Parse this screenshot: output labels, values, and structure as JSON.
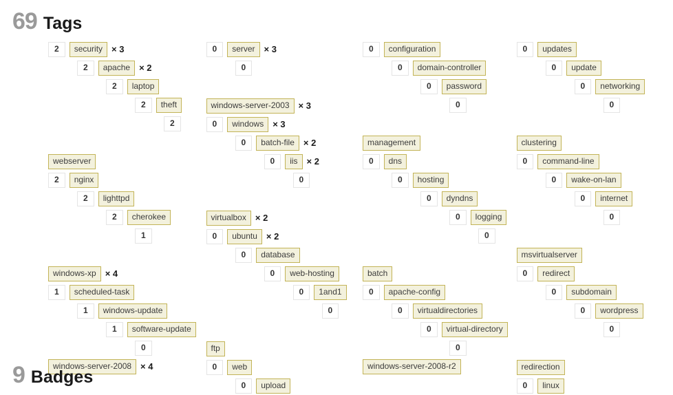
{
  "sections": {
    "tags": {
      "count": "69",
      "title": "Tags"
    },
    "badges": {
      "count": "9",
      "title": "Badges"
    }
  },
  "columns": [
    {
      "groups": [
        {
          "rows": [
            {
              "count": "2",
              "tag": "security",
              "mult": "× 3"
            },
            {
              "indent": 1,
              "count": "2",
              "tag": "apache",
              "mult": "× 2"
            },
            {
              "indent": 2,
              "count": "2",
              "tag": "laptop"
            },
            {
              "indent": 3,
              "count": "2",
              "tag": "theft"
            },
            {
              "indent": 4,
              "count": "2"
            }
          ]
        },
        {
          "rows": [
            {
              "tag": "webserver"
            },
            {
              "count": "2",
              "tag": "nginx"
            },
            {
              "indent": 1,
              "count": "2",
              "tag": "lighttpd"
            },
            {
              "indent": 2,
              "count": "2",
              "tag": "cherokee"
            },
            {
              "indent": 3,
              "count": "1"
            }
          ]
        },
        {
          "rows": [
            {
              "tag": "windows-xp",
              "mult": "× 4"
            },
            {
              "count": "1",
              "tag": "scheduled-task"
            },
            {
              "indent": 1,
              "count": "1",
              "tag": "windows-update"
            },
            {
              "indent": 2,
              "count": "1",
              "tag": "software-update"
            },
            {
              "indent": 3,
              "count": "0"
            },
            {
              "tag": "windows-server-2008",
              "mult": "× 4"
            }
          ]
        }
      ]
    },
    {
      "groups": [
        {
          "rows": [
            {
              "count": "0",
              "tag": "server",
              "mult": "× 3"
            },
            {
              "indent": 1,
              "count": "0"
            }
          ]
        },
        {
          "rows": [
            {
              "tag": "windows-server-2003",
              "mult": "× 3"
            },
            {
              "count": "0",
              "tag": "windows",
              "mult": "× 3"
            },
            {
              "indent": 1,
              "count": "0",
              "tag": "batch-file",
              "mult": "× 2"
            },
            {
              "indent": 2,
              "count": "0",
              "tag": "iis",
              "mult": "× 2"
            },
            {
              "indent": 3,
              "count": "0"
            }
          ]
        },
        {
          "rows": [
            {
              "tag": "virtualbox",
              "mult": "× 2"
            },
            {
              "count": "0",
              "tag": "ubuntu",
              "mult": "× 2"
            },
            {
              "indent": 1,
              "count": "0",
              "tag": "database"
            },
            {
              "indent": 2,
              "count": "0",
              "tag": "web-hosting"
            },
            {
              "indent": 3,
              "count": "0",
              "tag": "1and1"
            },
            {
              "indent": 4,
              "count": "0"
            }
          ]
        },
        {
          "rows": [
            {
              "tag": "ftp"
            },
            {
              "count": "0",
              "tag": "web"
            },
            {
              "indent": 1,
              "count": "0",
              "tag": "upload"
            }
          ]
        }
      ]
    },
    {
      "groups": [
        {
          "rows": [
            {
              "count": "0",
              "tag": "configuration"
            },
            {
              "indent": 1,
              "count": "0",
              "tag": "domain-controller"
            },
            {
              "indent": 2,
              "count": "0",
              "tag": "password"
            },
            {
              "indent": 3,
              "count": "0"
            }
          ]
        },
        {
          "rows": [
            {
              "tag": "management"
            },
            {
              "count": "0",
              "tag": "dns"
            },
            {
              "indent": 1,
              "count": "0",
              "tag": "hosting"
            },
            {
              "indent": 2,
              "count": "0",
              "tag": "dyndns"
            },
            {
              "indent": 3,
              "count": "0",
              "tag": "logging"
            },
            {
              "indent": 4,
              "count": "0"
            }
          ]
        },
        {
          "rows": [
            {
              "tag": "batch"
            },
            {
              "count": "0",
              "tag": "apache-config"
            },
            {
              "indent": 1,
              "count": "0",
              "tag": "virtualdirectories"
            },
            {
              "indent": 2,
              "count": "0",
              "tag": "virtual-directory"
            },
            {
              "indent": 3,
              "count": "0"
            },
            {
              "tag": "windows-server-2008-r2"
            }
          ]
        }
      ]
    },
    {
      "groups": [
        {
          "rows": [
            {
              "count": "0",
              "tag": "updates"
            },
            {
              "indent": 1,
              "count": "0",
              "tag": "update"
            },
            {
              "indent": 2,
              "count": "0",
              "tag": "networking"
            },
            {
              "indent": 3,
              "count": "0"
            }
          ]
        },
        {
          "rows": [
            {
              "tag": "clustering"
            },
            {
              "count": "0",
              "tag": "command-line"
            },
            {
              "indent": 1,
              "count": "0",
              "tag": "wake-on-lan"
            },
            {
              "indent": 2,
              "count": "0",
              "tag": "internet"
            },
            {
              "indent": 3,
              "count": "0"
            }
          ]
        },
        {
          "rows": [
            {
              "tag": "msvirtualserver"
            },
            {
              "count": "0",
              "tag": "redirect"
            },
            {
              "indent": 1,
              "count": "0",
              "tag": "subdomain"
            },
            {
              "indent": 2,
              "count": "0",
              "tag": "wordpress"
            },
            {
              "indent": 3,
              "count": "0"
            }
          ]
        },
        {
          "rows": [
            {
              "tag": "redirection"
            },
            {
              "count": "0",
              "tag": "linux"
            }
          ]
        }
      ]
    }
  ]
}
